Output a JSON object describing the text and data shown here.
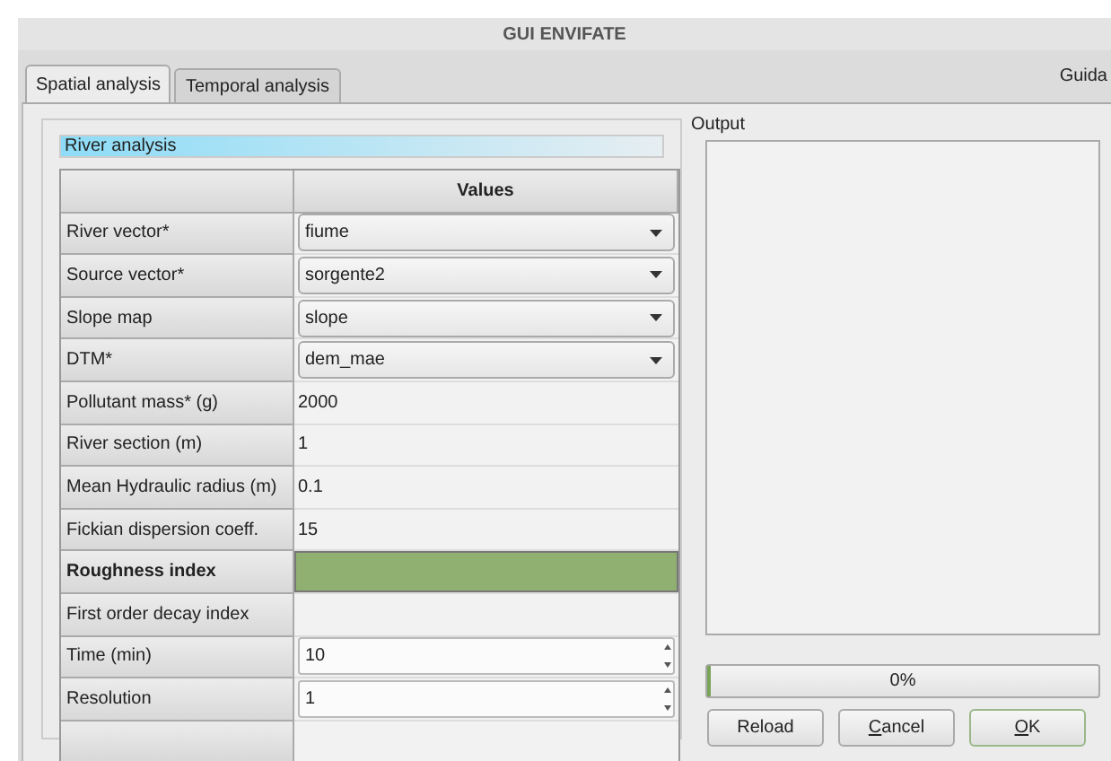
{
  "window": {
    "title": "GUI ENVIFATE"
  },
  "help_label": "Guida",
  "tabs": [
    {
      "label": "Spatial analysis",
      "selected": true
    },
    {
      "label": "Temporal analysis",
      "selected": false
    }
  ],
  "section_title": "River analysis",
  "table": {
    "columns": [
      "",
      "Values"
    ],
    "rows": [
      {
        "label": "River vector*",
        "kind": "combo",
        "value": "fiume"
      },
      {
        "label": "Source vector*",
        "kind": "combo",
        "value": "sorgente2"
      },
      {
        "label": "Slope map",
        "kind": "combo",
        "value": "slope"
      },
      {
        "label": "DTM*",
        "kind": "combo",
        "value": "dem_mae"
      },
      {
        "label": "Pollutant mass* (g)",
        "kind": "text",
        "value": "2000"
      },
      {
        "label": "River section (m)",
        "kind": "text",
        "value": "1"
      },
      {
        "label": "Mean Hydraulic radius (m)",
        "kind": "text",
        "value": "0.1"
      },
      {
        "label": "Fickian dispersion coeff.",
        "kind": "text",
        "value": "15"
      },
      {
        "label": "Roughness index",
        "kind": "color",
        "bold": true,
        "color": "#8fb070"
      },
      {
        "label": "First order decay index",
        "kind": "text",
        "value": ""
      },
      {
        "label": "Time (min)",
        "kind": "spin",
        "value": "10"
      },
      {
        "label": "Resolution",
        "kind": "spin",
        "value": "1"
      },
      {
        "kind": "empty"
      }
    ]
  },
  "output": {
    "label": "Output"
  },
  "progress": {
    "level": 0.0,
    "reading": "0%"
  },
  "buttons": [
    {
      "label": "Reload",
      "mnemonic": false,
      "default": false
    },
    {
      "label": "Cancel",
      "mnemonic": true,
      "default": false
    },
    {
      "label": "OK",
      "mnemonic": true,
      "default": true
    }
  ]
}
